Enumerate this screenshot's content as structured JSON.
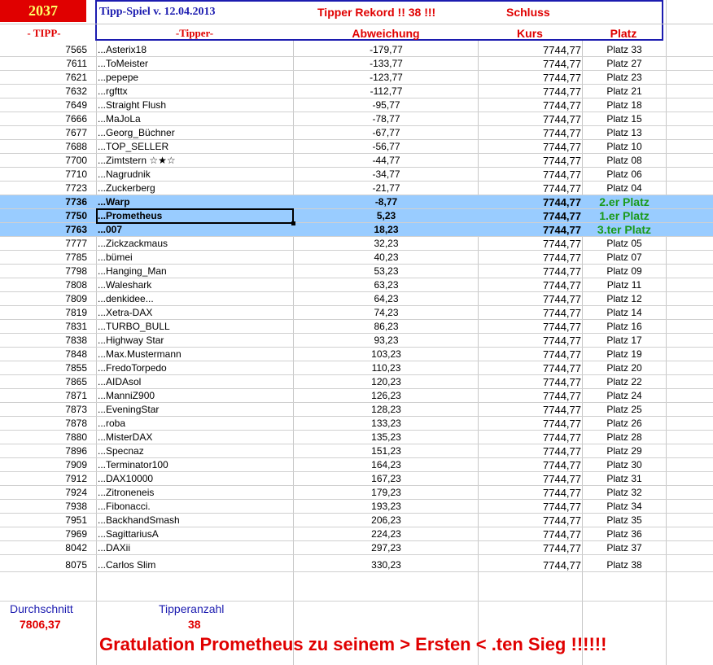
{
  "header": {
    "code": "2037",
    "title": "Tipp-Spiel v. 12.04.2013",
    "rekord": "Tipper Rekord !!  38  !!!",
    "schluss": "Schluss",
    "col_tipp": "- TIPP-",
    "col_tipper": "-Tipper-",
    "col_abweichung": "Abweichung",
    "col_kurs": "Kurs",
    "col_platz": "Platz"
  },
  "rows": [
    {
      "tipp": "7565",
      "name": "...Asterix18",
      "abw": "-179,77",
      "kurs": "7744,77",
      "platz": "Platz 33"
    },
    {
      "tipp": "7611",
      "name": "...ToMeister",
      "abw": "-133,77",
      "kurs": "7744,77",
      "platz": "Platz 27"
    },
    {
      "tipp": "7621",
      "name": "...pepepe",
      "abw": "-123,77",
      "kurs": "7744,77",
      "platz": "Platz 23"
    },
    {
      "tipp": "7632",
      "name": "...rgfttx",
      "abw": "-112,77",
      "kurs": "7744,77",
      "platz": "Platz 21"
    },
    {
      "tipp": "7649",
      "name": "...Straight Flush",
      "abw": "-95,77",
      "kurs": "7744,77",
      "platz": "Platz 18"
    },
    {
      "tipp": "7666",
      "name": "...MaJoLa",
      "abw": "-78,77",
      "kurs": "7744,77",
      "platz": "Platz 15"
    },
    {
      "tipp": "7677",
      "name": "...Georg_Büchner",
      "abw": "-67,77",
      "kurs": "7744,77",
      "platz": "Platz 13"
    },
    {
      "tipp": "7688",
      "name": "...TOP_SELLER",
      "abw": "-56,77",
      "kurs": "7744,77",
      "platz": "Platz 10"
    },
    {
      "tipp": "7700",
      "name": "...Zimtstern ☆★☆",
      "abw": "-44,77",
      "kurs": "7744,77",
      "platz": "Platz 08"
    },
    {
      "tipp": "7710",
      "name": "...Nagrudnik",
      "abw": "-34,77",
      "kurs": "7744,77",
      "platz": "Platz 06"
    },
    {
      "tipp": "7723",
      "name": "...Zuckerberg",
      "abw": "-21,77",
      "kurs": "7744,77",
      "platz": "Platz 04"
    },
    {
      "tipp": "7736",
      "name": "...Warp",
      "abw": "-8,77",
      "kurs": "7744,77",
      "platz": "2.er Platz",
      "hl": true
    },
    {
      "tipp": "7750",
      "name": "...Prometheus",
      "abw": "5,23",
      "kurs": "7744,77",
      "platz": "1.er Platz",
      "hl": true,
      "selected": true
    },
    {
      "tipp": "7763",
      "name": "...007",
      "abw": "18,23",
      "kurs": "7744,77",
      "platz": "3.ter Platz",
      "hl": true
    },
    {
      "tipp": "7777",
      "name": "...Zickzackmaus",
      "abw": "32,23",
      "kurs": "7744,77",
      "platz": "Platz 05"
    },
    {
      "tipp": "7785",
      "name": "...bümei",
      "abw": "40,23",
      "kurs": "7744,77",
      "platz": "Platz 07"
    },
    {
      "tipp": "7798",
      "name": "...Hanging_Man",
      "abw": "53,23",
      "kurs": "7744,77",
      "platz": "Platz 09"
    },
    {
      "tipp": "7808",
      "name": "...Waleshark",
      "abw": "63,23",
      "kurs": "7744,77",
      "platz": "Platz 11"
    },
    {
      "tipp": "7809",
      "name": "...denkidee...",
      "abw": "64,23",
      "kurs": "7744,77",
      "platz": "Platz 12"
    },
    {
      "tipp": "7819",
      "name": "...Xetra-DAX",
      "abw": "74,23",
      "kurs": "7744,77",
      "platz": "Platz 14"
    },
    {
      "tipp": "7831",
      "name": "...TURBO_BULL",
      "abw": "86,23",
      "kurs": "7744,77",
      "platz": "Platz 16"
    },
    {
      "tipp": "7838",
      "name": "...Highway Star",
      "abw": "93,23",
      "kurs": "7744,77",
      "platz": "Platz 17"
    },
    {
      "tipp": "7848",
      "name": "...Max.Mustermann",
      "abw": "103,23",
      "kurs": "7744,77",
      "platz": "Platz 19"
    },
    {
      "tipp": "7855",
      "name": "...FredoTorpedo",
      "abw": "110,23",
      "kurs": "7744,77",
      "platz": "Platz 20"
    },
    {
      "tipp": "7865",
      "name": "...AIDAsol",
      "abw": "120,23",
      "kurs": "7744,77",
      "platz": "Platz 22"
    },
    {
      "tipp": "7871",
      "name": "...ManniZ900",
      "abw": "126,23",
      "kurs": "7744,77",
      "platz": "Platz 24"
    },
    {
      "tipp": "7873",
      "name": "...EveningStar",
      "abw": "128,23",
      "kurs": "7744,77",
      "platz": "Platz 25"
    },
    {
      "tipp": "7878",
      "name": "...roba",
      "abw": "133,23",
      "kurs": "7744,77",
      "platz": "Platz 26"
    },
    {
      "tipp": "7880",
      "name": "...MisterDAX",
      "abw": "135,23",
      "kurs": "7744,77",
      "platz": "Platz 28"
    },
    {
      "tipp": "7896",
      "name": "...Specnaz",
      "abw": "151,23",
      "kurs": "7744,77",
      "platz": "Platz 29"
    },
    {
      "tipp": "7909",
      "name": "...Terminator100",
      "abw": "164,23",
      "kurs": "7744,77",
      "platz": "Platz 30"
    },
    {
      "tipp": "7912",
      "name": "...DAX10000",
      "abw": "167,23",
      "kurs": "7744,77",
      "platz": "Platz 31"
    },
    {
      "tipp": "7924",
      "name": "...Zitroneneis",
      "abw": "179,23",
      "kurs": "7744,77",
      "platz": "Platz 32"
    },
    {
      "tipp": "7938",
      "name": "...Fibonacci.",
      "abw": "193,23",
      "kurs": "7744,77",
      "platz": "Platz 34"
    },
    {
      "tipp": "7951",
      "name": "...BackhandSmash",
      "abw": "206,23",
      "kurs": "7744,77",
      "platz": "Platz 35"
    },
    {
      "tipp": "7969",
      "name": "...SagittariusA",
      "abw": "224,23",
      "kurs": "7744,77",
      "platz": "Platz 36"
    },
    {
      "tipp": "8042",
      "name": "...DAXii",
      "abw": "297,23",
      "kurs": "7744,77",
      "platz": "Platz 37"
    },
    {
      "tipp": "8075",
      "name": "...Carlos Slim",
      "abw": "330,23",
      "kurs": "7744,77",
      "platz": "Platz 38"
    }
  ],
  "footer": {
    "durchschnitt_label": "Durchschnitt",
    "durchschnitt_value": "7806,37",
    "tipperanzahl_label": "Tipperanzahl",
    "tipperanzahl_value": "38",
    "gratulation": "Gratulation Prometheus zu seinem > Ersten < .ten Sieg !!!!!!"
  },
  "colors": {
    "red": "#e00000",
    "blue": "#1c1cb0",
    "highlight": "#99ccff",
    "green": "#1a9a1a",
    "code_bg": "#e00000",
    "code_fg": "#ffff66"
  }
}
